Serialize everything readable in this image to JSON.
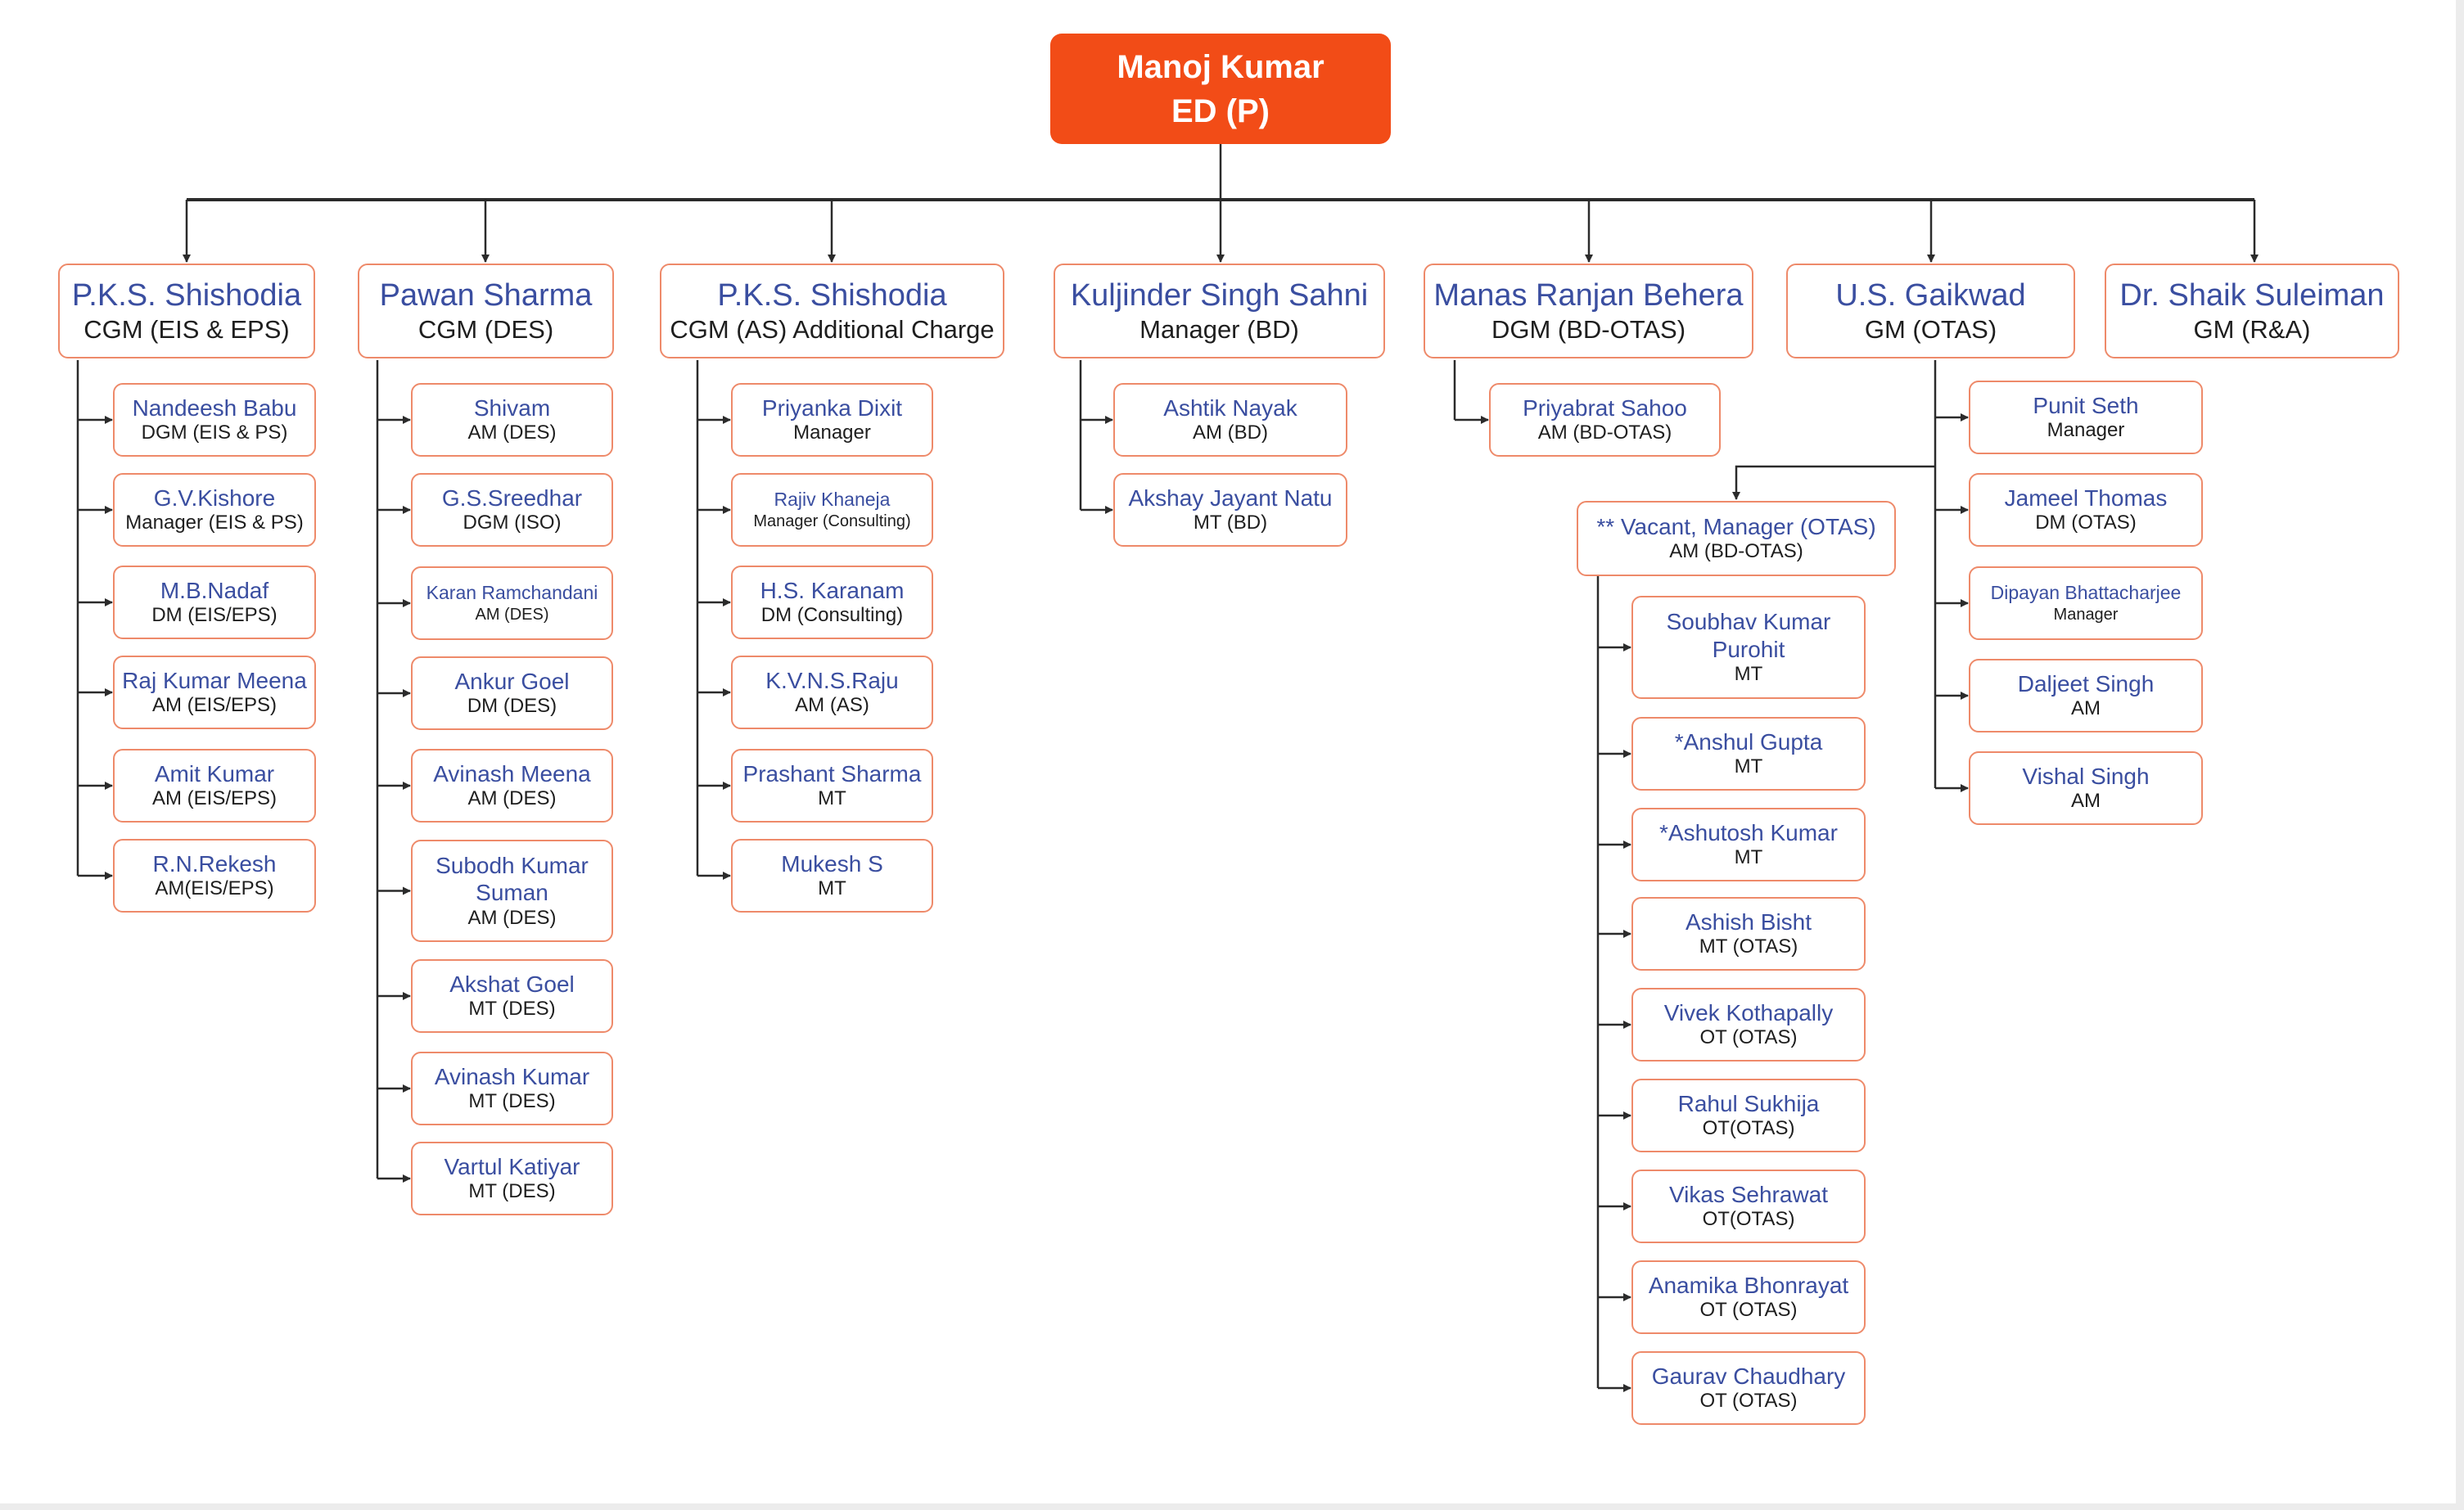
{
  "colors": {
    "root_fill": "#f24c17",
    "node_border": "#ee8a6a",
    "name_text": "#3a4ea0",
    "title_text": "#1e1e1e",
    "connector": "#2b2b2b"
  },
  "root": {
    "name": "Manoj Kumar",
    "title": "ED (P)"
  },
  "heads": [
    {
      "name": "P.K.S. Shishodia",
      "title": "CGM (EIS & EPS)",
      "reports": [
        {
          "name": "Nandeesh Babu",
          "title": "DGM (EIS & PS)"
        },
        {
          "name": "G.V.Kishore",
          "title": "Manager (EIS & PS)"
        },
        {
          "name": "M.B.Nadaf",
          "title": "DM (EIS/EPS)"
        },
        {
          "name": "Raj Kumar Meena",
          "title": "AM (EIS/EPS)"
        },
        {
          "name": "Amit Kumar",
          "title": "AM (EIS/EPS)"
        },
        {
          "name": "R.N.Rekesh",
          "title": "AM(EIS/EPS)"
        }
      ]
    },
    {
      "name": "Pawan Sharma",
      "title": "CGM (DES)",
      "reports": [
        {
          "name": "Shivam",
          "title": "AM (DES)"
        },
        {
          "name": "G.S.Sreedhar",
          "title": "DGM (ISO)"
        },
        {
          "name": "Karan Ramchandani",
          "title": "AM (DES)"
        },
        {
          "name": "Ankur Goel",
          "title": "DM (DES)"
        },
        {
          "name": "Avinash Meena",
          "title": "AM (DES)"
        },
        {
          "name": "Subodh Kumar Suman",
          "title": "AM (DES)"
        },
        {
          "name": "Akshat Goel",
          "title": "MT (DES)"
        },
        {
          "name": "Avinash Kumar",
          "title": "MT (DES)"
        },
        {
          "name": "Vartul Katiyar",
          "title": "MT (DES)"
        }
      ]
    },
    {
      "name": "P.K.S. Shishodia",
      "title": "CGM (AS) Additional Charge",
      "reports": [
        {
          "name": "Priyanka Dixit",
          "title": "Manager"
        },
        {
          "name": "Rajiv Khaneja",
          "title": "Manager (Consulting)"
        },
        {
          "name": "H.S. Karanam",
          "title": "DM (Consulting)"
        },
        {
          "name": "K.V.N.S.Raju",
          "title": "AM (AS)"
        },
        {
          "name": "Prashant Sharma",
          "title": "MT"
        },
        {
          "name": "Mukesh S",
          "title": "MT"
        }
      ]
    },
    {
      "name": "Kuljinder Singh Sahni",
      "title": "Manager (BD)",
      "reports": [
        {
          "name": "Ashtik Nayak",
          "title": "AM (BD)"
        },
        {
          "name": "Akshay Jayant Natu",
          "title": "MT (BD)"
        }
      ]
    },
    {
      "name": "Manas Ranjan Behera",
      "title": "DGM (BD-OTAS)",
      "reports": [
        {
          "name": "Priyabrat Sahoo",
          "title": "AM (BD-OTAS)"
        }
      ]
    },
    {
      "name": "U.S. Gaikwad",
      "title": "GM (OTAS)",
      "reports": [
        {
          "name": "Punit Seth",
          "title": "Manager"
        },
        {
          "name": "Jameel Thomas",
          "title": "DM (OTAS)"
        },
        {
          "name": "Dipayan Bhattacharjee",
          "title": "Manager"
        },
        {
          "name": "Daljeet Singh",
          "title": "AM"
        },
        {
          "name": "Vishal Singh",
          "title": "AM"
        }
      ],
      "sub_unit": {
        "name": "** Vacant, Manager (OTAS)",
        "title": "AM (BD-OTAS)",
        "reports": [
          {
            "name": "Soubhav Kumar Purohit",
            "title": "MT"
          },
          {
            "name": "*Anshul Gupta",
            "title": "MT"
          },
          {
            "name": "*Ashutosh Kumar",
            "title": "MT"
          },
          {
            "name": "Ashish Bisht",
            "title": "MT (OTAS)"
          },
          {
            "name": "Vivek Kothapally",
            "title": "OT (OTAS)"
          },
          {
            "name": "Rahul Sukhija",
            "title": "OT(OTAS)"
          },
          {
            "name": "Vikas Sehrawat",
            "title": "OT(OTAS)"
          },
          {
            "name": "Anamika Bhonrayat",
            "title": "OT (OTAS)"
          },
          {
            "name": "Gaurav Chaudhary",
            "title": "OT (OTAS)"
          }
        ]
      }
    },
    {
      "name": "Dr. Shaik Suleiman",
      "title": "GM (R&A)",
      "reports": []
    }
  ]
}
